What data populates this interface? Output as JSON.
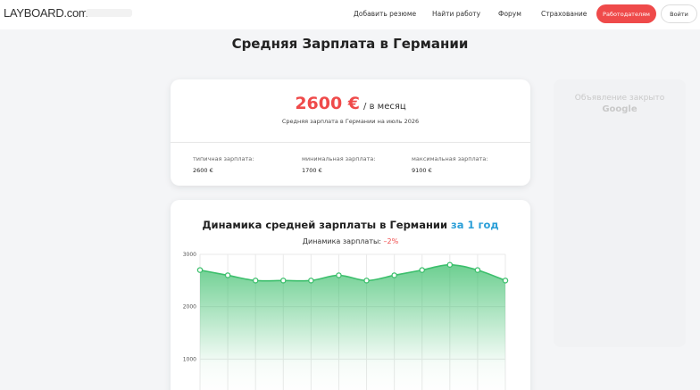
{
  "header": {
    "logo": "LAYBOARD.com",
    "nav": [
      {
        "label": "Добавить резюме"
      },
      {
        "label": "Найти работу"
      },
      {
        "label": "Форум"
      },
      {
        "label": "Страхование"
      }
    ],
    "employer_button": "Работодателям",
    "login_button": "Войти"
  },
  "page_title": "Средняя Зарплата в Германии",
  "salary_card": {
    "amount": "2600 €",
    "per_month": "/ в месяц",
    "subtitle": "Средняя зарплата в Германии на июль 2026",
    "stats": [
      {
        "label": "типичная зарплата:",
        "value": "2600 €"
      },
      {
        "label": "минимальная зарплата:",
        "value": "1700 €"
      },
      {
        "label": "максимальная зарплата:",
        "value": "9100 €"
      }
    ]
  },
  "ad": {
    "text": "Объявление закрыто",
    "brand": "Google"
  },
  "chart_card": {
    "title": "Динамика средней зарплаты в Германии",
    "period": "за 1 год",
    "trend_label": "Динамика зарплаты:",
    "trend_value": "–2%"
  },
  "colors": {
    "accent_red": "#ef4a4a",
    "accent_blue": "#2b9fd8",
    "series_green": "#3cbf6c"
  },
  "chart_data": {
    "type": "area",
    "title": "Динамика средней зарплаты в Германии",
    "xlabel": "",
    "ylabel": "",
    "y_ticks": [
      3000,
      2000,
      1000
    ],
    "ylim": [
      0,
      3000
    ],
    "grid": true,
    "series": [
      {
        "values": [
          2700,
          2600,
          2500,
          2500,
          2500,
          2600,
          2500,
          2600,
          2700,
          2800,
          2700,
          2500
        ]
      }
    ]
  }
}
